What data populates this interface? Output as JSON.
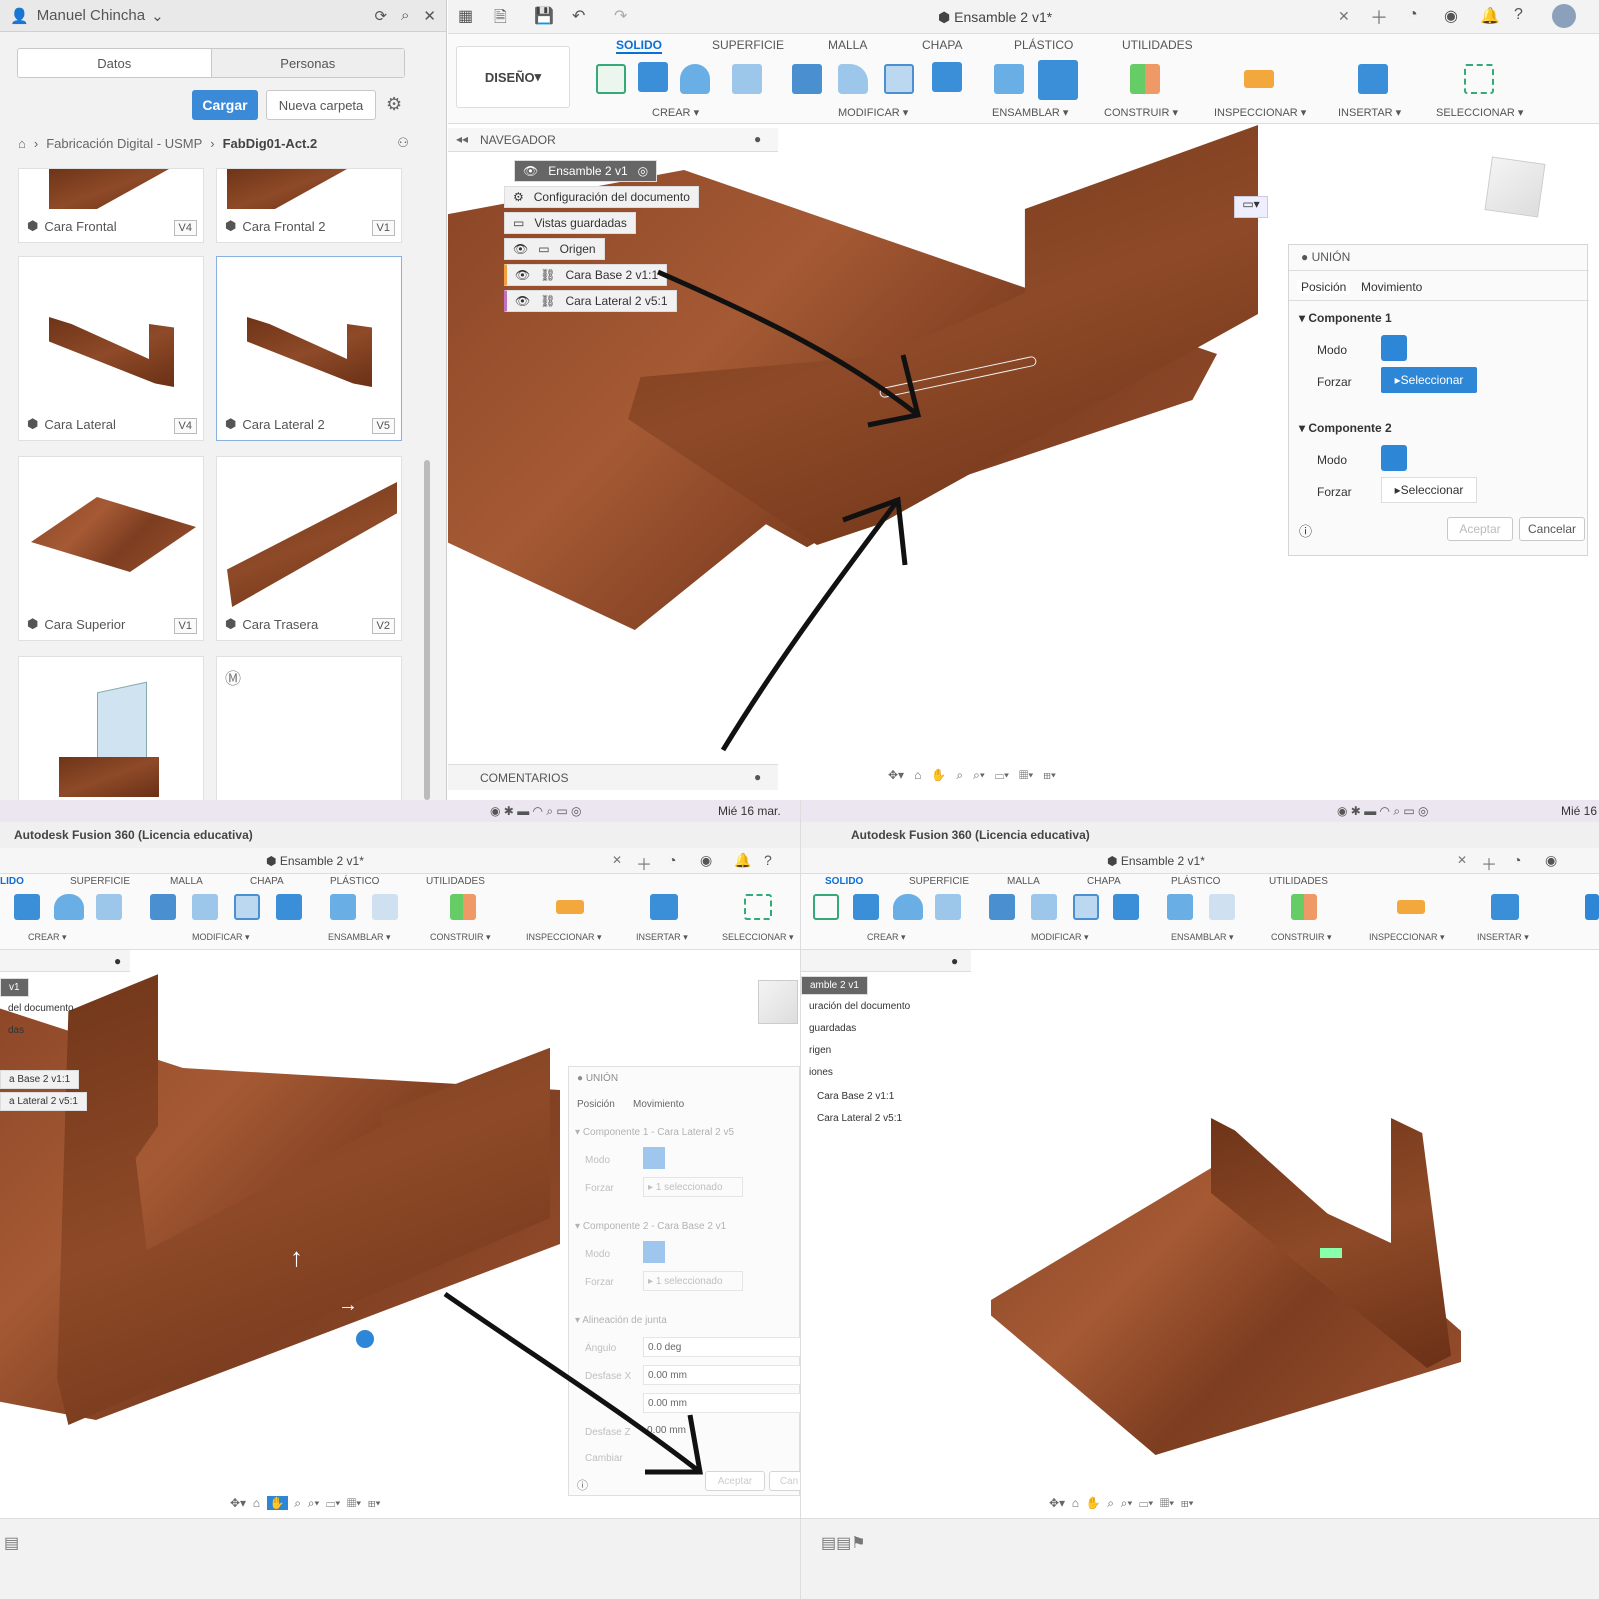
{
  "top_left": {
    "user": "Manuel Chincha",
    "tabs": [
      "Datos",
      "Personas"
    ],
    "buttons": {
      "upload": "Cargar",
      "new_folder": "Nueva carpeta"
    },
    "breadcrumb": [
      "Fabricación Digital - USMP",
      "FabDig01-Act.2"
    ],
    "tiles": [
      {
        "name": "Cara Frontal",
        "version": "V4"
      },
      {
        "name": "Cara Frontal 2",
        "version": "V1"
      },
      {
        "name": "Cara Lateral",
        "version": "V4"
      },
      {
        "name": "Cara Lateral 2",
        "version": "V5"
      },
      {
        "name": "Cara Superior",
        "version": "V1"
      },
      {
        "name": "Cara Trasera",
        "version": "V2"
      }
    ]
  },
  "top_right": {
    "doc_title": "Ensamble 2 v1*",
    "workspace": "DISEÑO",
    "tabs": [
      "SOLIDO",
      "SUPERFICIE",
      "MALLA",
      "CHAPA",
      "PLÁSTICO",
      "UTILIDADES"
    ],
    "groups": [
      "CREAR",
      "MODIFICAR",
      "ENSAMBLAR",
      "CONSTRUIR",
      "INSPECCIONAR",
      "INSERTAR",
      "SELECCIONAR"
    ],
    "navigator": {
      "title": "NAVEGADOR",
      "root": "Ensamble 2 v1",
      "items": [
        "Configuración del documento",
        "Vistas guardadas",
        "Origen",
        "Cara Base 2 v1:1",
        "Cara Lateral 2 v5:1"
      ]
    },
    "comments": "COMENTARIOS",
    "join": {
      "title": "UNIÓN",
      "tabs": [
        "Posición",
        "Movimiento"
      ],
      "comp1": "Componente 1",
      "comp2": "Componente 2",
      "mode": "Modo",
      "snap": "Forzar",
      "select": "Seleccionar",
      "ok": "Aceptar",
      "cancel": "Cancelar"
    }
  },
  "bottom": {
    "menubar_date": "Mié 16 mar.",
    "menubar_date_right": "Mié 16",
    "app_title": "Autodesk Fusion 360 (Licencia educativa)",
    "doc_title": "Ensamble 2 v1*",
    "tabs_left": [
      "LIDO",
      "SUPERFICIE",
      "MALLA",
      "CHAPA",
      "PLÁSTICO",
      "UTILIDADES"
    ],
    "tabs_right": [
      "SOLIDO",
      "SUPERFICIE",
      "MALLA",
      "CHAPA",
      "PLÁSTICO",
      "UTILIDADES"
    ],
    "groups": [
      "CREAR",
      "MODIFICAR",
      "ENSAMBLAR",
      "CONSTRUIR",
      "INSPECCIONAR",
      "INSERTAR",
      "SELECCIONAR"
    ],
    "left_nav": [
      "v1",
      "del documento",
      "das",
      "a Base 2 v1:1",
      "a Lateral 2 v5:1"
    ],
    "join": {
      "title": "UNIÓN",
      "tabs": [
        "Posición",
        "Movimiento"
      ],
      "comp1": "Componente 1 - Cara Lateral 2 v5",
      "comp2": "Componente 2 - Cara Base 2 v1",
      "mode": "Modo",
      "snap": "Forzar",
      "selected": "1 seleccionado",
      "align": "Alineación de junta",
      "angle": "Ángulo",
      "angle_val": "0.0 deg",
      "offx": "Desfase X",
      "offx_val": "0.00 mm",
      "offy_val": "0.00 mm",
      "offz": "Desfase Z",
      "offz_val": "0.00 mm",
      "flip": "Cambiar",
      "ok": "Aceptar",
      "cancel": "Can"
    },
    "right_nav": [
      "amble 2 v1",
      "uración del documento",
      "guardadas",
      "rigen",
      "iones",
      "Cara Base 2 v1:1",
      "Cara Lateral 2 v5:1"
    ]
  }
}
